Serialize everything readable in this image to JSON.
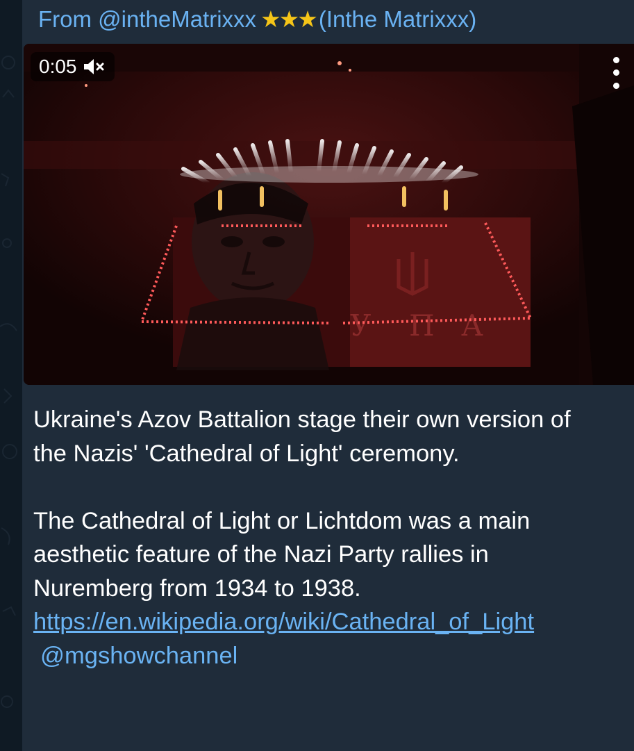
{
  "message": {
    "forward_prefix": "From @intheMatrixxx",
    "forward_stars": "★★★",
    "forward_name": "(Inthe Matrixxx)",
    "video": {
      "duration": "0:05",
      "muted": true,
      "mute_icon": "volume-muted-icon",
      "menu_icon": "more-vertical-icon",
      "banner_letters": [
        "У",
        "П",
        "А"
      ]
    },
    "caption": {
      "para1": "Ukraine's Azov Battalion stage their own version of the Nazis' 'Cathedral of Light' ceremony.",
      "para2": "The Cathedral of Light or Lichtdom was a main aesthetic feature of the Nazi Party rallies in Nuremberg from 1934 to 1938.",
      "link": "https://en.wikipedia.org/wiki/Cathedral_of_Light",
      "mention": "@mgshowchannel"
    }
  },
  "colors": {
    "chat_background": "#0f1a24",
    "bubble": "#1f2c3a",
    "link": "#6ab3f3",
    "stars": "#f5c518"
  }
}
